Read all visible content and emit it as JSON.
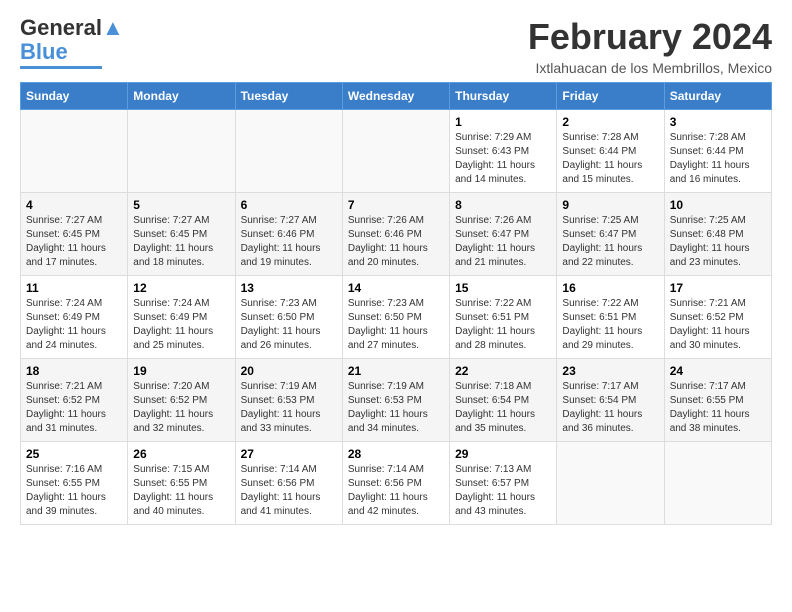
{
  "header": {
    "logo": {
      "line1": "General",
      "line2": "Blue"
    },
    "title": "February 2024",
    "location": "Ixtlahuacan de los Membrillos, Mexico"
  },
  "days_of_week": [
    "Sunday",
    "Monday",
    "Tuesday",
    "Wednesday",
    "Thursday",
    "Friday",
    "Saturday"
  ],
  "weeks": [
    [
      {
        "num": "",
        "info": ""
      },
      {
        "num": "",
        "info": ""
      },
      {
        "num": "",
        "info": ""
      },
      {
        "num": "",
        "info": ""
      },
      {
        "num": "1",
        "info": "Sunrise: 7:29 AM\nSunset: 6:43 PM\nDaylight: 11 hours\nand 14 minutes."
      },
      {
        "num": "2",
        "info": "Sunrise: 7:28 AM\nSunset: 6:44 PM\nDaylight: 11 hours\nand 15 minutes."
      },
      {
        "num": "3",
        "info": "Sunrise: 7:28 AM\nSunset: 6:44 PM\nDaylight: 11 hours\nand 16 minutes."
      }
    ],
    [
      {
        "num": "4",
        "info": "Sunrise: 7:27 AM\nSunset: 6:45 PM\nDaylight: 11 hours\nand 17 minutes."
      },
      {
        "num": "5",
        "info": "Sunrise: 7:27 AM\nSunset: 6:45 PM\nDaylight: 11 hours\nand 18 minutes."
      },
      {
        "num": "6",
        "info": "Sunrise: 7:27 AM\nSunset: 6:46 PM\nDaylight: 11 hours\nand 19 minutes."
      },
      {
        "num": "7",
        "info": "Sunrise: 7:26 AM\nSunset: 6:46 PM\nDaylight: 11 hours\nand 20 minutes."
      },
      {
        "num": "8",
        "info": "Sunrise: 7:26 AM\nSunset: 6:47 PM\nDaylight: 11 hours\nand 21 minutes."
      },
      {
        "num": "9",
        "info": "Sunrise: 7:25 AM\nSunset: 6:47 PM\nDaylight: 11 hours\nand 22 minutes."
      },
      {
        "num": "10",
        "info": "Sunrise: 7:25 AM\nSunset: 6:48 PM\nDaylight: 11 hours\nand 23 minutes."
      }
    ],
    [
      {
        "num": "11",
        "info": "Sunrise: 7:24 AM\nSunset: 6:49 PM\nDaylight: 11 hours\nand 24 minutes."
      },
      {
        "num": "12",
        "info": "Sunrise: 7:24 AM\nSunset: 6:49 PM\nDaylight: 11 hours\nand 25 minutes."
      },
      {
        "num": "13",
        "info": "Sunrise: 7:23 AM\nSunset: 6:50 PM\nDaylight: 11 hours\nand 26 minutes."
      },
      {
        "num": "14",
        "info": "Sunrise: 7:23 AM\nSunset: 6:50 PM\nDaylight: 11 hours\nand 27 minutes."
      },
      {
        "num": "15",
        "info": "Sunrise: 7:22 AM\nSunset: 6:51 PM\nDaylight: 11 hours\nand 28 minutes."
      },
      {
        "num": "16",
        "info": "Sunrise: 7:22 AM\nSunset: 6:51 PM\nDaylight: 11 hours\nand 29 minutes."
      },
      {
        "num": "17",
        "info": "Sunrise: 7:21 AM\nSunset: 6:52 PM\nDaylight: 11 hours\nand 30 minutes."
      }
    ],
    [
      {
        "num": "18",
        "info": "Sunrise: 7:21 AM\nSunset: 6:52 PM\nDaylight: 11 hours\nand 31 minutes."
      },
      {
        "num": "19",
        "info": "Sunrise: 7:20 AM\nSunset: 6:52 PM\nDaylight: 11 hours\nand 32 minutes."
      },
      {
        "num": "20",
        "info": "Sunrise: 7:19 AM\nSunset: 6:53 PM\nDaylight: 11 hours\nand 33 minutes."
      },
      {
        "num": "21",
        "info": "Sunrise: 7:19 AM\nSunset: 6:53 PM\nDaylight: 11 hours\nand 34 minutes."
      },
      {
        "num": "22",
        "info": "Sunrise: 7:18 AM\nSunset: 6:54 PM\nDaylight: 11 hours\nand 35 minutes."
      },
      {
        "num": "23",
        "info": "Sunrise: 7:17 AM\nSunset: 6:54 PM\nDaylight: 11 hours\nand 36 minutes."
      },
      {
        "num": "24",
        "info": "Sunrise: 7:17 AM\nSunset: 6:55 PM\nDaylight: 11 hours\nand 38 minutes."
      }
    ],
    [
      {
        "num": "25",
        "info": "Sunrise: 7:16 AM\nSunset: 6:55 PM\nDaylight: 11 hours\nand 39 minutes."
      },
      {
        "num": "26",
        "info": "Sunrise: 7:15 AM\nSunset: 6:55 PM\nDaylight: 11 hours\nand 40 minutes."
      },
      {
        "num": "27",
        "info": "Sunrise: 7:14 AM\nSunset: 6:56 PM\nDaylight: 11 hours\nand 41 minutes."
      },
      {
        "num": "28",
        "info": "Sunrise: 7:14 AM\nSunset: 6:56 PM\nDaylight: 11 hours\nand 42 minutes."
      },
      {
        "num": "29",
        "info": "Sunrise: 7:13 AM\nSunset: 6:57 PM\nDaylight: 11 hours\nand 43 minutes."
      },
      {
        "num": "",
        "info": ""
      },
      {
        "num": "",
        "info": ""
      }
    ]
  ]
}
